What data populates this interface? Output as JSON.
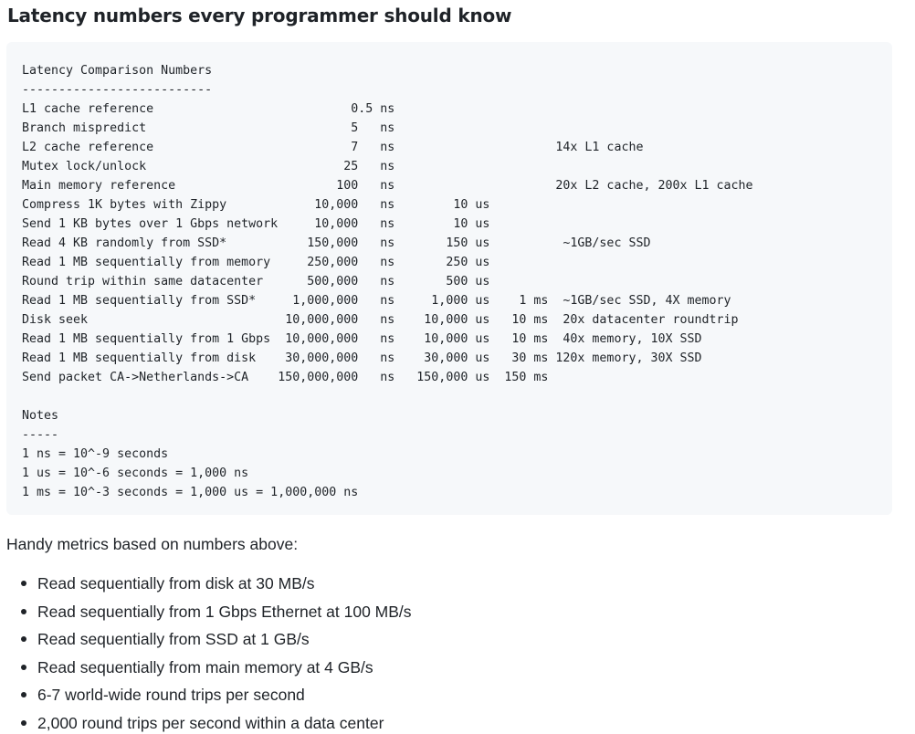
{
  "heading": "Latency numbers every programmer should know",
  "code_lines": [
    "Latency Comparison Numbers",
    "--------------------------",
    "L1 cache reference                           0.5 ns",
    "Branch mispredict                            5   ns",
    "L2 cache reference                           7   ns                      14x L1 cache",
    "Mutex lock/unlock                           25   ns",
    "Main memory reference                      100   ns                      20x L2 cache, 200x L1 cache",
    "Compress 1K bytes with Zippy            10,000   ns        10 us",
    "Send 1 KB bytes over 1 Gbps network     10,000   ns        10 us",
    "Read 4 KB randomly from SSD*           150,000   ns       150 us          ~1GB/sec SSD",
    "Read 1 MB sequentially from memory     250,000   ns       250 us",
    "Round trip within same datacenter      500,000   ns       500 us",
    "Read 1 MB sequentially from SSD*     1,000,000   ns     1,000 us    1 ms  ~1GB/sec SSD, 4X memory",
    "Disk seek                           10,000,000   ns    10,000 us   10 ms  20x datacenter roundtrip",
    "Read 1 MB sequentially from 1 Gbps  10,000,000   ns    10,000 us   10 ms  40x memory, 10X SSD",
    "Read 1 MB sequentially from disk    30,000,000   ns    30,000 us   30 ms 120x memory, 30X SSD",
    "Send packet CA->Netherlands->CA    150,000,000   ns   150,000 us  150 ms",
    "",
    "Notes",
    "-----",
    "1 ns = 10^-9 seconds",
    "1 us = 10^-6 seconds = 1,000 ns",
    "1 ms = 10^-3 seconds = 1,000 us = 1,000,000 ns"
  ],
  "intro": "Handy metrics based on numbers above:",
  "metrics": [
    "Read sequentially from disk at 30 MB/s",
    "Read sequentially from 1 Gbps Ethernet at 100 MB/s",
    "Read sequentially from SSD at 1 GB/s",
    "Read sequentially from main memory at 4 GB/s",
    "6-7 world-wide round trips per second",
    "2,000 round trips per second within a data center"
  ]
}
